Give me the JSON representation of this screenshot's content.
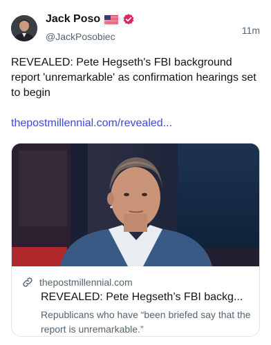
{
  "author": {
    "display_name": "Jack Poso",
    "handle": "@JackPosobiec",
    "flag_icon": "us-flag-icon",
    "verified_icon": "verified-badge-icon",
    "verified_color": "#e0245e"
  },
  "post": {
    "time": "11m",
    "text": "REVEALED: Pete Hegseth's FBI background report 'unremarkable' as confirmation hearings set to begin",
    "link": "thepostmillennial.com/revealed..."
  },
  "card": {
    "domain": "thepostmillennial.com",
    "title": "REVEALED: Pete Hegseth’s FBI backg...",
    "description": "Republicans who have “been briefed say that the report is unremarkable.”",
    "link_icon": "link-icon"
  },
  "colors": {
    "link": "#3b4bd6",
    "secondary_text": "#536471"
  }
}
